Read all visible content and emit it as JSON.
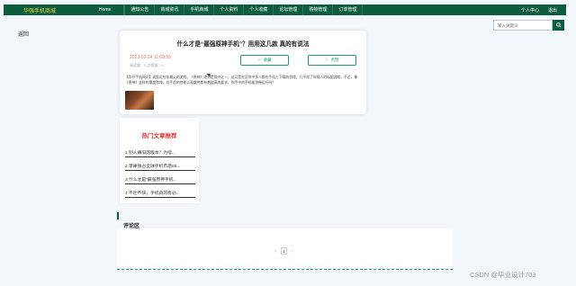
{
  "brand": "华强手机商城",
  "nav": {
    "home": "Home",
    "items": [
      "通知公告",
      "商城资讯",
      "手机商城",
      "个人资料",
      "个人收藏",
      "论坛管理",
      "购物管理",
      "订单管理"
    ],
    "right": [
      "个人中心",
      "退出"
    ]
  },
  "back_label": "返回",
  "search": {
    "placeholder": "输入关键词"
  },
  "article": {
    "title": "什么才是“最强原神手机”？用用这几款 真的有说法",
    "date": "2023-02-24 11:08:55",
    "meta": "阅读量：0    点赞量：0",
    "collect_label": "收藏",
    "like_label": "点赞",
    "body": "【华仔手机网讯】说起近些年最火的游戏，《原神》绝对是其中之一。这可是在区块中多人都在手机上下载的游戏，几乎成了年轻人的标配游戏，不过，像《原神》这样的重度游戏，对手机的性能以及散热都有着较高的要求，你手中的手机能流畅运行吗？"
  },
  "hot": {
    "title": "热门文章推荐",
    "items": [
      "1 别人嫌旧的版本？为啥...",
      "2 苹果独占全球手机市场65...",
      "3 什么才是“最强原神手机...",
      "4 不吐不快，手机真的有必..."
    ]
  },
  "comments": {
    "title": "评论区",
    "page": "1",
    "prev": "‹",
    "next": "›"
  },
  "watermark": "CSDN @毕业设计703",
  "colors": {
    "nav_bg": "#0d5c3e",
    "accent": "#19a06a",
    "brand": "#f2d23a",
    "hot_title": "#e23a3a",
    "date": "#e0707a"
  }
}
